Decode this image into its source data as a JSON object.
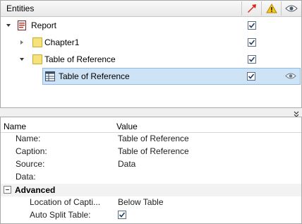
{
  "entities_panel": {
    "title": "Entities",
    "columns": {
      "visibility_icon": "red-arrow-icon",
      "warning_icon": "warning-icon",
      "view_icon": "eye-icon"
    },
    "rows": [
      {
        "label": "Report",
        "level": 0,
        "expanded": true,
        "checked": true
      },
      {
        "label": "Chapter1",
        "level": 1,
        "expanded": false,
        "checked": true
      },
      {
        "label": "Table of Reference",
        "level": 1,
        "expanded": true,
        "checked": true
      },
      {
        "label": "Table of Reference",
        "level": 2,
        "selected": true,
        "checked": true,
        "visible_eye": true
      }
    ]
  },
  "properties_panel": {
    "col_name": "Name",
    "col_value": "Value",
    "rows": [
      {
        "name": "Name:",
        "value": "Table of Reference"
      },
      {
        "name": "Caption:",
        "value": "Table of Reference"
      },
      {
        "name": "Source:",
        "value": "Data"
      },
      {
        "name": "Data:",
        "value": ""
      }
    ],
    "section": {
      "label": "Advanced",
      "rows": [
        {
          "name": "Location of Capti...",
          "value": "Below Table"
        },
        {
          "name": "Auto Split Table:",
          "checked": true
        }
      ]
    }
  },
  "colors": {
    "selection_bg": "#cfe3f6",
    "selection_border": "#8fbbe3",
    "folder": "#f6e27a",
    "accent_red": "#d9261c"
  }
}
